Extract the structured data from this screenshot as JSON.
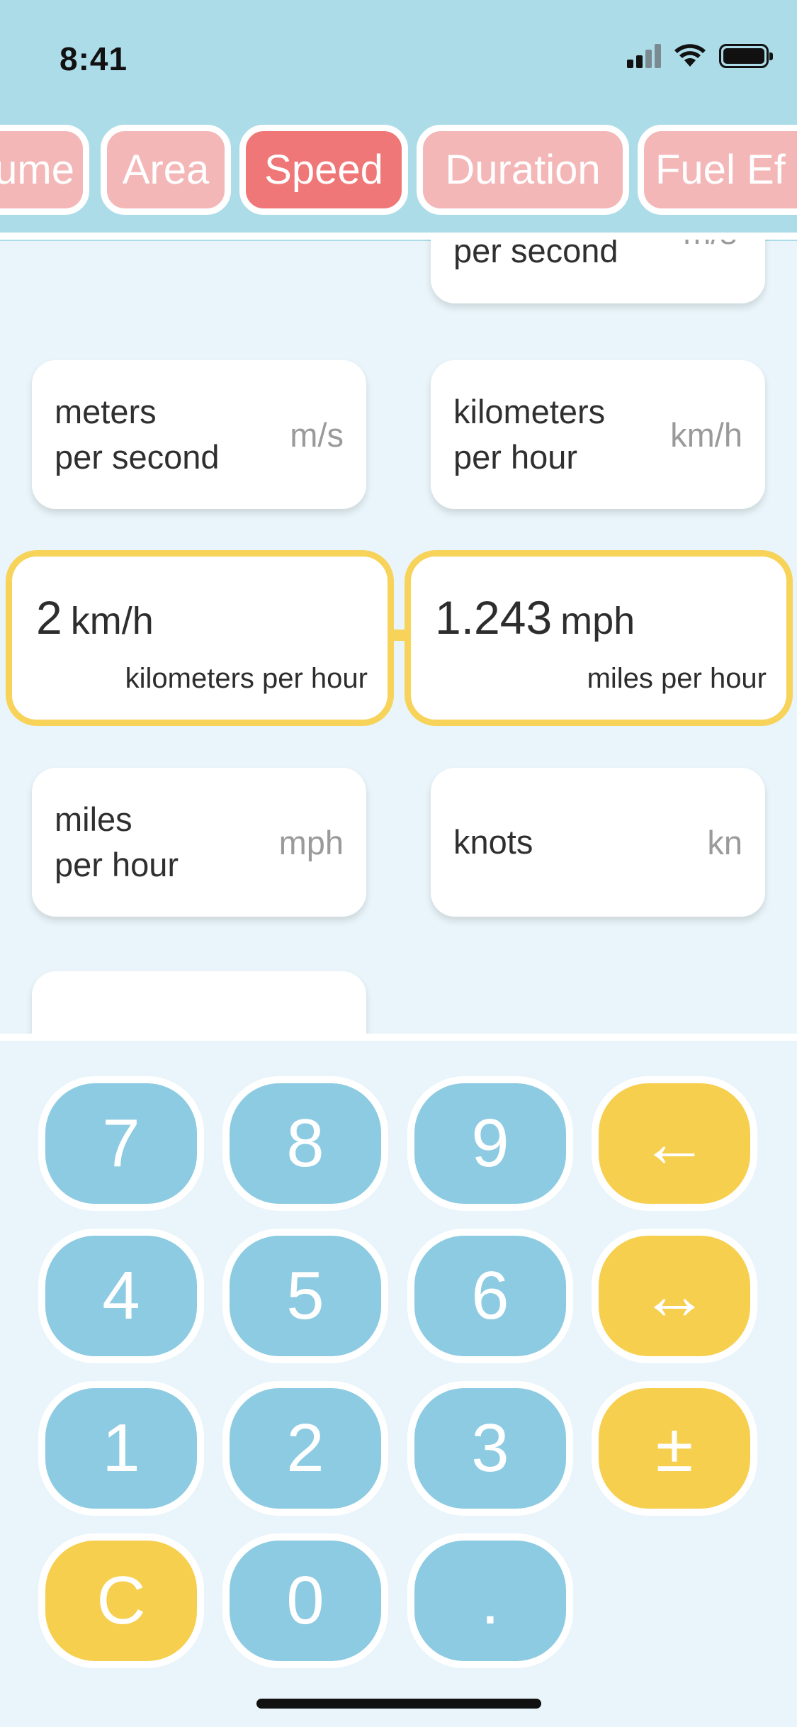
{
  "status_bar": {
    "time": "8:41"
  },
  "tabs": [
    "ume",
    "Area",
    "Speed",
    "Duration",
    "Fuel Ef"
  ],
  "cards": {
    "top_partial": {
      "name": "per second",
      "abbr": "m/s"
    },
    "meters_per_second": {
      "name_line1": "meters",
      "name_line2": "per second",
      "abbr": "m/s"
    },
    "kilometers_per_hour": {
      "name_line1": "kilometers",
      "name_line2": "per hour",
      "abbr": "km/h"
    },
    "miles_per_hour": {
      "name_line1": "miles",
      "name_line2": "per hour",
      "abbr": "mph"
    },
    "knots": {
      "name": "knots",
      "abbr": "kn"
    }
  },
  "conversion": {
    "from": {
      "value": "2",
      "unit": "km/h",
      "full": "kilometers per hour"
    },
    "to": {
      "value": "1.243",
      "unit": "mph",
      "full": "miles per hour"
    }
  },
  "keypad": {
    "k7": "7",
    "k8": "8",
    "k9": "9",
    "back": "←",
    "k4": "4",
    "k5": "5",
    "k6": "6",
    "swap": "↔",
    "k1": "1",
    "k2": "2",
    "k3": "3",
    "sign": "±",
    "clear": "C",
    "k0": "0",
    "dot": "."
  }
}
